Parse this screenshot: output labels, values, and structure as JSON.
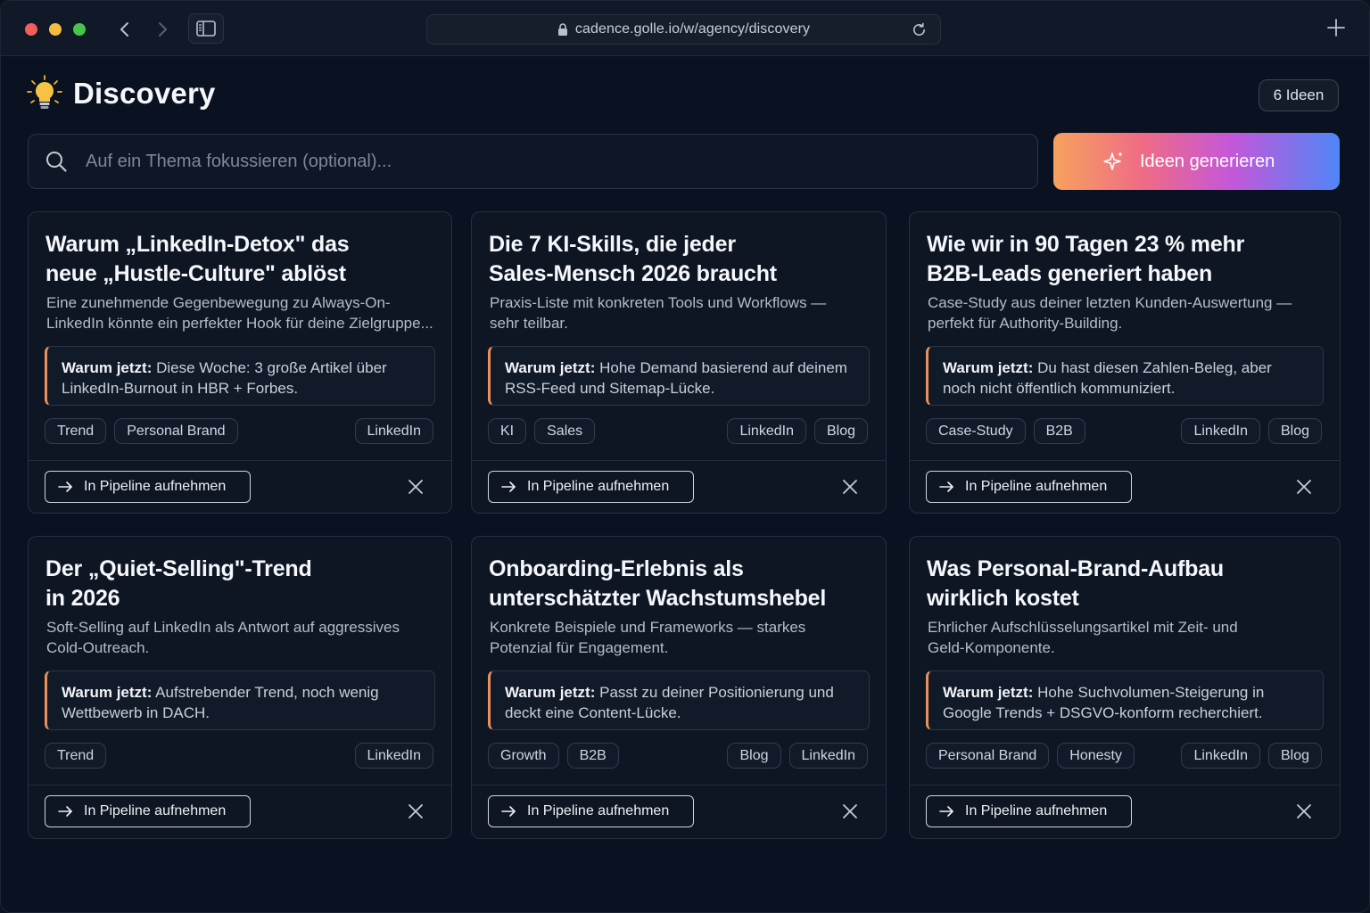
{
  "browser": {
    "url": "cadence.golle.io/w/agency/discovery"
  },
  "header": {
    "title": "Discovery",
    "count_badge": "6 Ideen"
  },
  "search": {
    "placeholder": "Auf ein Thema fokussieren (optional)..."
  },
  "generate_button": {
    "label": "Ideen generieren"
  },
  "ideas": [
    {
      "title_line1": "Warum „LinkedIn-Detox\" das",
      "title_line2": "neue „Hustle-Culture\" ablöst",
      "desc_line1": "Eine zunehmende Gegenbewegung zu Always-On-",
      "desc_line2": "LinkedIn könnte ein perfekter Hook für deine Zielgruppe...",
      "why_label": "Warum jetzt:",
      "why_line1": "Diese Woche: 3 große Artikel über",
      "why_line2": "LinkedIn-Burnout in HBR + Forbes.",
      "tags": [
        "Trend",
        "Personal Brand"
      ],
      "channels": [
        "LinkedIn"
      ],
      "action": "In Pipeline aufnehmen"
    },
    {
      "title_line1": "Die 7 KI-Skills, die jeder",
      "title_line2": "Sales-Mensch 2026 braucht",
      "desc_line1": "Praxis-Liste mit konkreten Tools und Workflows —",
      "desc_line2": "sehr teilbar.",
      "why_label": "Warum jetzt:",
      "why_line1": "Hohe Demand basierend auf deinem",
      "why_line2": "RSS-Feed und Sitemap-Lücke.",
      "tags": [
        "KI",
        "Sales"
      ],
      "channels": [
        "LinkedIn",
        "Blog"
      ],
      "action": "In Pipeline aufnehmen"
    },
    {
      "title_line1": "Wie wir in 90 Tagen 23 % mehr",
      "title_line2": "B2B-Leads generiert haben",
      "desc_line1": "Case-Study aus deiner letzten Kunden-Auswertung —",
      "desc_line2": "perfekt für Authority-Building.",
      "why_label": "Warum jetzt:",
      "why_line1": "Du hast diesen Zahlen-Beleg, aber",
      "why_line2": "noch nicht öffentlich kommuniziert.",
      "tags": [
        "Case-Study",
        "B2B"
      ],
      "channels": [
        "LinkedIn",
        "Blog"
      ],
      "action": "In Pipeline aufnehmen"
    },
    {
      "title_line1": "Der „Quiet-Selling\"-Trend",
      "title_line2": "in 2026",
      "desc_line1": "Soft-Selling auf LinkedIn als Antwort auf aggressives",
      "desc_line2": "Cold-Outreach.",
      "why_label": "Warum jetzt:",
      "why_line1": "Aufstrebender Trend, noch wenig",
      "why_line2": "Wettbewerb in DACH.",
      "tags": [
        "Trend"
      ],
      "channels": [
        "LinkedIn"
      ],
      "action": "In Pipeline aufnehmen"
    },
    {
      "title_line1": "Onboarding-Erlebnis als",
      "title_line2": "unterschätzter Wachstumshebel",
      "desc_line1": "Konkrete Beispiele und Frameworks — starkes",
      "desc_line2": "Potenzial für Engagement.",
      "why_label": "Warum jetzt:",
      "why_line1": "Passt zu deiner Positionierung und",
      "why_line2": "deckt eine Content-Lücke.",
      "tags": [
        "Growth",
        "B2B"
      ],
      "channels": [
        "Blog",
        "LinkedIn"
      ],
      "action": "In Pipeline aufnehmen"
    },
    {
      "title_line1": "Was Personal-Brand-Aufbau",
      "title_line2": "wirklich kostet",
      "desc_line1": "Ehrlicher Aufschlüsselungsartikel mit Zeit- und",
      "desc_line2": "Geld-Komponente.",
      "why_label": "Warum jetzt:",
      "why_line1": "Hohe Suchvolumen-Steigerung in",
      "why_line2": "Google Trends + DSGVO-konform recherchiert.",
      "tags": [
        "Personal Brand",
        "Honesty"
      ],
      "channels": [
        "LinkedIn",
        "Blog"
      ],
      "action": "In Pipeline aufnehmen"
    }
  ],
  "colors": {
    "background": "#0a1120",
    "card_bg": "#0e1624",
    "why_accent": "#e8915a",
    "generate_gradient": [
      "#f7a25e",
      "#ef6a87",
      "#c557d9",
      "#4f86f7"
    ]
  },
  "icons": {
    "header": "lightbulb-icon",
    "search": "search-icon",
    "generate": "sparkle-icon",
    "action": "arrow-right-icon",
    "dismiss": "close-icon"
  }
}
